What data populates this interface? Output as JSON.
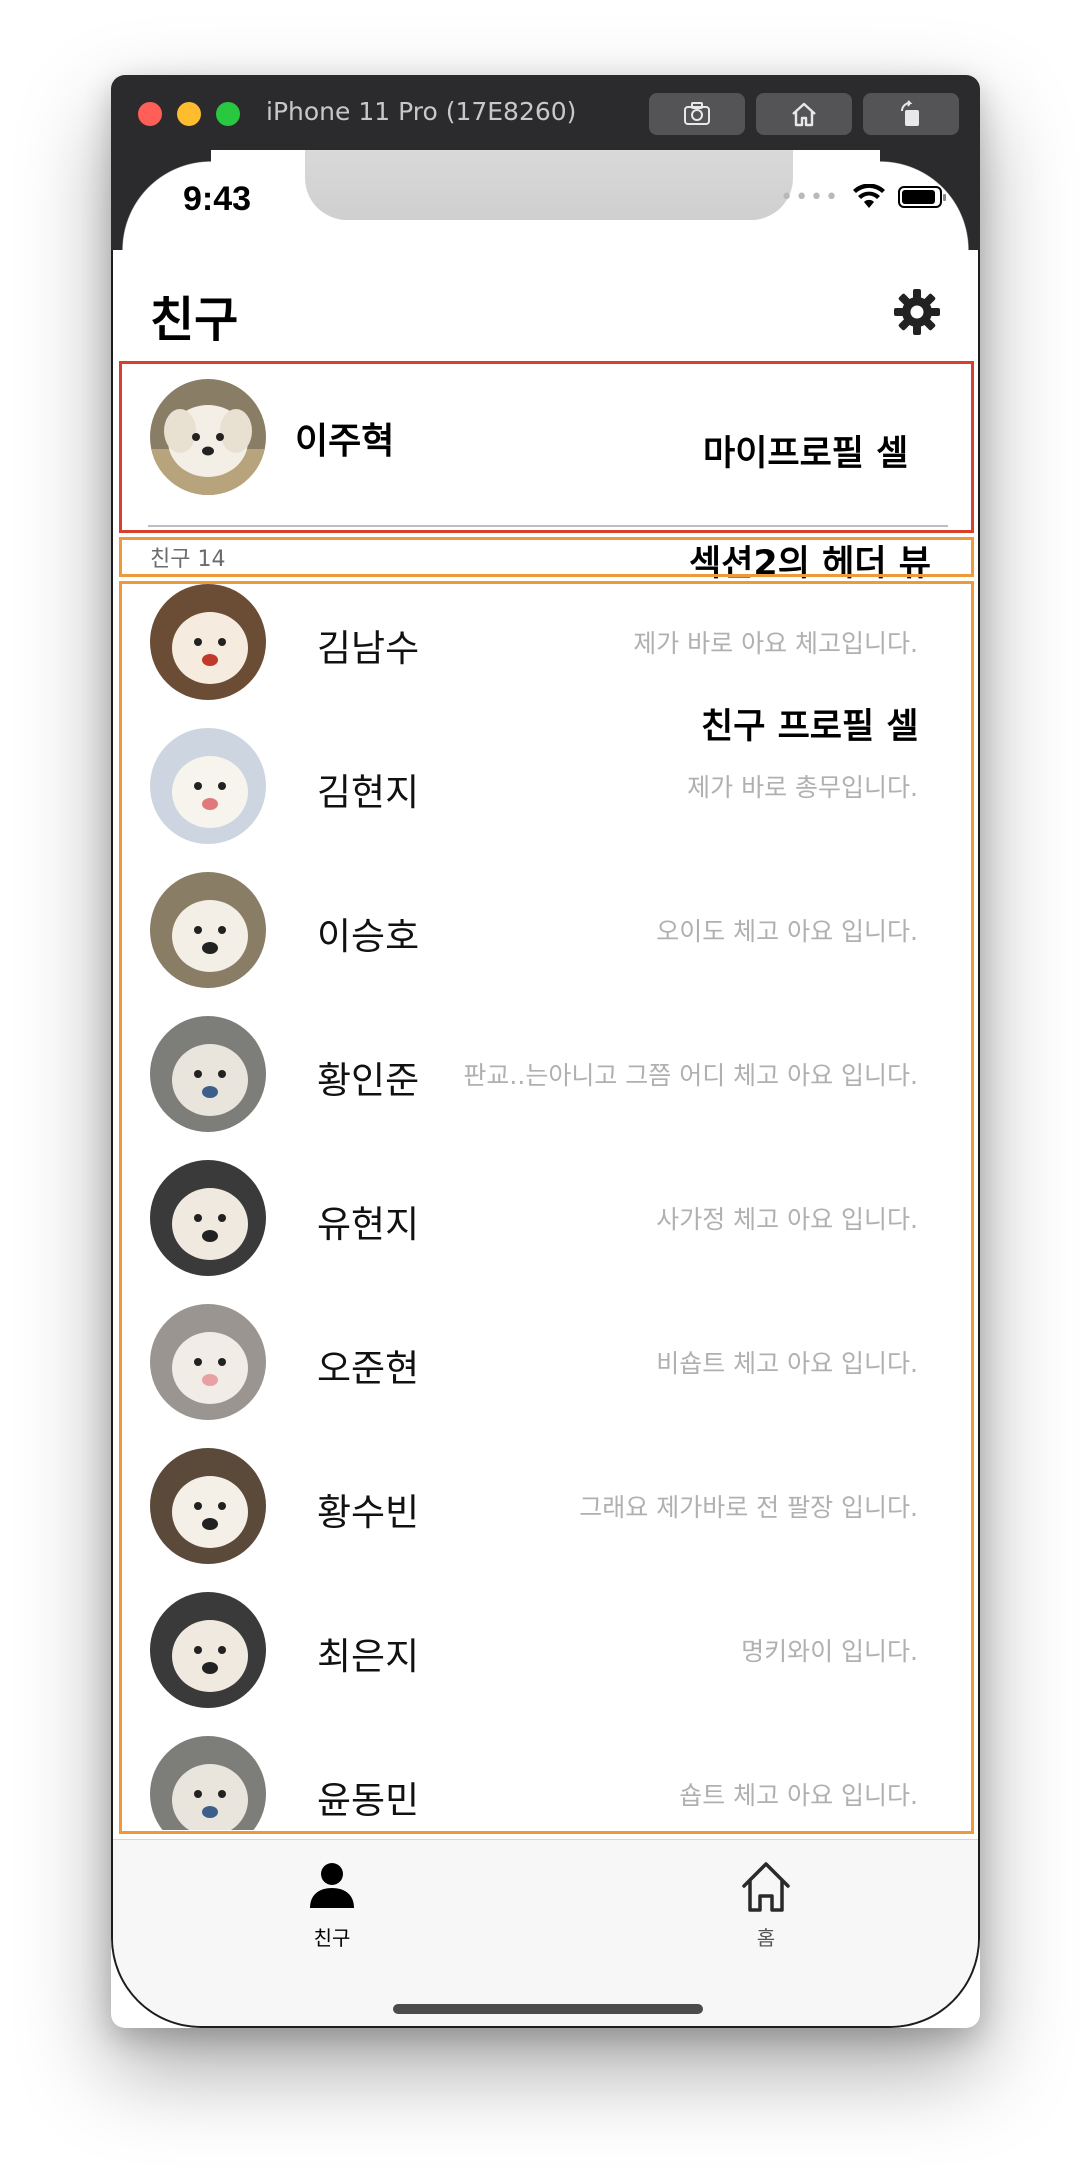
{
  "simulator": {
    "title": "iPhone 11 Pro (17E8260)",
    "buttons": [
      {
        "icon": "screenshot-icon"
      },
      {
        "icon": "home-icon"
      },
      {
        "icon": "rotate-icon"
      }
    ]
  },
  "status_bar": {
    "time": "9:43",
    "dots": "••••"
  },
  "nav": {
    "title": "친구",
    "settings_icon": "gear-icon"
  },
  "my_profile": {
    "name": "이주혁"
  },
  "section_header": {
    "text": "친구 14"
  },
  "annotations": {
    "my_profile_cell": "마이프로필 셀",
    "section_header_view": "섹션2의 헤더 뷰",
    "friend_profile_cell": "친구 프로필 셀",
    "colors": {
      "red": "#d9402b",
      "orange": "#ef9a3a"
    }
  },
  "friends": [
    {
      "name": "김남수",
      "status": "제가 바로 아요 체고입니다.",
      "avatar": "dog-yawning"
    },
    {
      "name": "김현지",
      "status": "제가 바로 총무입니다.",
      "avatar": "dog-smiling"
    },
    {
      "name": "이승호",
      "status": "오이도 체고 아요 입니다.",
      "avatar": "dog-lying"
    },
    {
      "name": "황인준",
      "status": "판교..는아니고 그쯤 어디 체고 아요 입니다.",
      "avatar": "dog-street"
    },
    {
      "name": "유현지",
      "status": "사가정 체고 아요 입니다.",
      "avatar": "dog-door"
    },
    {
      "name": "오준현",
      "status": "비숍트 체고 아요 입니다.",
      "avatar": "cat-closeup"
    },
    {
      "name": "황수빈",
      "status": "그래요 제가바로 전 팔장 입니다.",
      "avatar": "dog-sitting"
    },
    {
      "name": "최은지",
      "status": "명키와이 입니다.",
      "avatar": "dog-door"
    },
    {
      "name": "윤동민",
      "status": "숍트 체고 아요 입니다.",
      "avatar": "dog-street"
    }
  ],
  "tabbar": {
    "tabs": [
      {
        "label": "친구",
        "icon": "person-icon",
        "selected": true
      },
      {
        "label": "홈",
        "icon": "house-icon",
        "selected": false
      }
    ]
  }
}
